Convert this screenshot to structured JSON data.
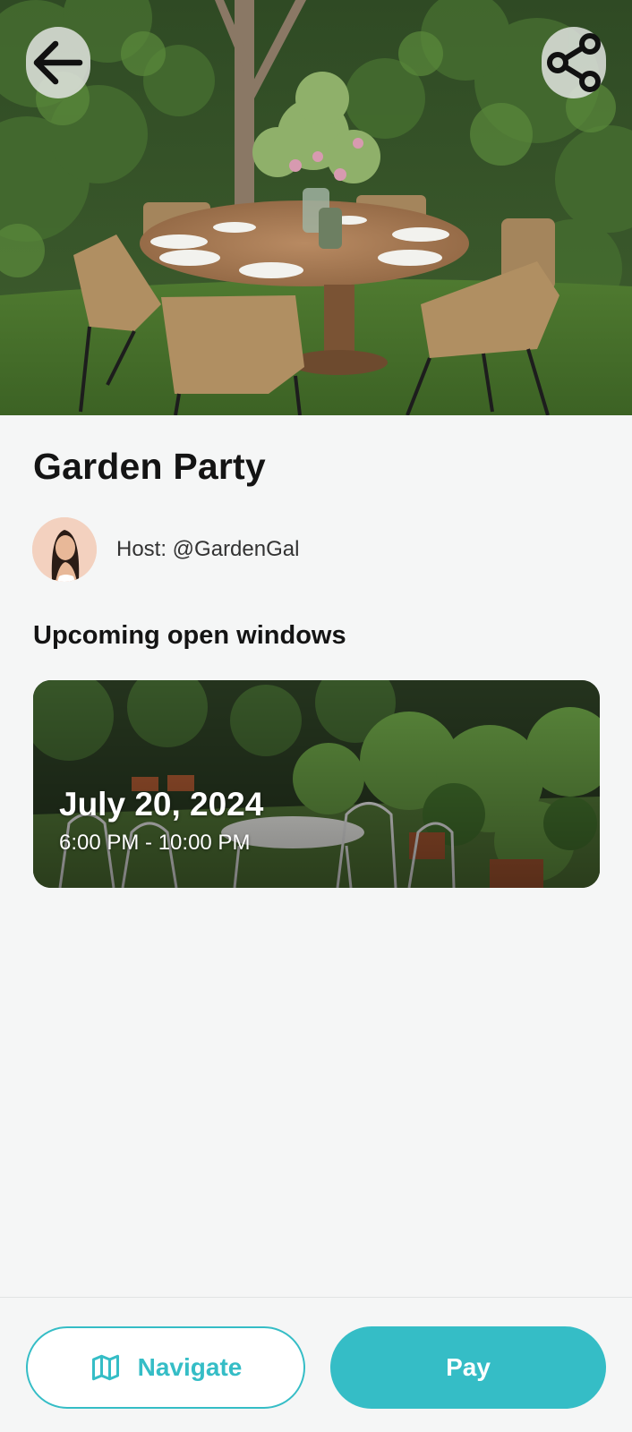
{
  "event": {
    "title": "Garden Party",
    "host_label": "Host: @GardenGal"
  },
  "windows": {
    "section_title": "Upcoming open windows",
    "items": [
      {
        "date": "July 20, 2024",
        "time": "6:00 PM - 10:00 PM"
      }
    ]
  },
  "actions": {
    "navigate_label": "Navigate",
    "pay_label": "Pay"
  },
  "icons": {
    "back": "arrow-left-icon",
    "share": "share-icon",
    "navigate": "map-icon"
  },
  "colors": {
    "accent": "#35bdc6",
    "background": "#f5f6f6",
    "text": "#141414"
  }
}
